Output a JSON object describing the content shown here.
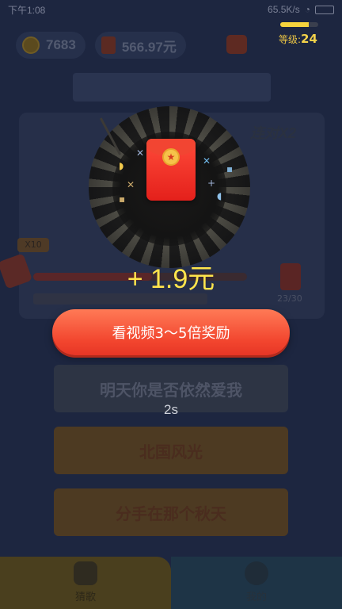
{
  "status_bar": {
    "time": "下午1:08",
    "network": "65.5K/s"
  },
  "header": {
    "coins": "7683",
    "cash": "566.97元",
    "level_label": "等级:",
    "level_value": "24",
    "level_progress": 0.75
  },
  "quiz": {
    "badge": "连对X2",
    "multiplier_tag": "X10",
    "reward_count": "23/30"
  },
  "answers": [
    "明天你是否依然爱我",
    "北国风光",
    "分手在那个秋天"
  ],
  "bottom_tabs": [
    {
      "label": "猜歌",
      "icon": "music-icon"
    },
    {
      "label": "我的",
      "icon": "profile-icon"
    }
  ],
  "popup": {
    "reward_text": "+ 1.9元",
    "video_button_label": "看视频3～5倍奖励",
    "countdown": "2s",
    "envelope_icon": "red-envelope-icon",
    "accent_color": "#ffe54c"
  }
}
